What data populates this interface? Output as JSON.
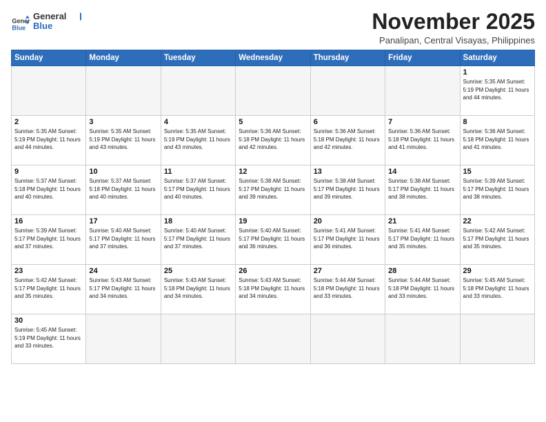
{
  "header": {
    "logo_line1": "General",
    "logo_line2": "Blue",
    "month": "November 2025",
    "location": "Panalipan, Central Visayas, Philippines"
  },
  "weekdays": [
    "Sunday",
    "Monday",
    "Tuesday",
    "Wednesday",
    "Thursday",
    "Friday",
    "Saturday"
  ],
  "weeks": [
    [
      {
        "day": "",
        "info": ""
      },
      {
        "day": "",
        "info": ""
      },
      {
        "day": "",
        "info": ""
      },
      {
        "day": "",
        "info": ""
      },
      {
        "day": "",
        "info": ""
      },
      {
        "day": "",
        "info": ""
      },
      {
        "day": "1",
        "info": "Sunrise: 5:35 AM\nSunset: 5:19 PM\nDaylight: 11 hours\nand 44 minutes."
      }
    ],
    [
      {
        "day": "2",
        "info": "Sunrise: 5:35 AM\nSunset: 5:19 PM\nDaylight: 11 hours\nand 44 minutes."
      },
      {
        "day": "3",
        "info": "Sunrise: 5:35 AM\nSunset: 5:19 PM\nDaylight: 11 hours\nand 43 minutes."
      },
      {
        "day": "4",
        "info": "Sunrise: 5:35 AM\nSunset: 5:19 PM\nDaylight: 11 hours\nand 43 minutes."
      },
      {
        "day": "5",
        "info": "Sunrise: 5:36 AM\nSunset: 5:18 PM\nDaylight: 11 hours\nand 42 minutes."
      },
      {
        "day": "6",
        "info": "Sunrise: 5:36 AM\nSunset: 5:18 PM\nDaylight: 11 hours\nand 42 minutes."
      },
      {
        "day": "7",
        "info": "Sunrise: 5:36 AM\nSunset: 5:18 PM\nDaylight: 11 hours\nand 41 minutes."
      },
      {
        "day": "8",
        "info": "Sunrise: 5:36 AM\nSunset: 5:18 PM\nDaylight: 11 hours\nand 41 minutes."
      }
    ],
    [
      {
        "day": "9",
        "info": "Sunrise: 5:37 AM\nSunset: 5:18 PM\nDaylight: 11 hours\nand 40 minutes."
      },
      {
        "day": "10",
        "info": "Sunrise: 5:37 AM\nSunset: 5:18 PM\nDaylight: 11 hours\nand 40 minutes."
      },
      {
        "day": "11",
        "info": "Sunrise: 5:37 AM\nSunset: 5:17 PM\nDaylight: 11 hours\nand 40 minutes."
      },
      {
        "day": "12",
        "info": "Sunrise: 5:38 AM\nSunset: 5:17 PM\nDaylight: 11 hours\nand 39 minutes."
      },
      {
        "day": "13",
        "info": "Sunrise: 5:38 AM\nSunset: 5:17 PM\nDaylight: 11 hours\nand 39 minutes."
      },
      {
        "day": "14",
        "info": "Sunrise: 5:38 AM\nSunset: 5:17 PM\nDaylight: 11 hours\nand 38 minutes."
      },
      {
        "day": "15",
        "info": "Sunrise: 5:39 AM\nSunset: 5:17 PM\nDaylight: 11 hours\nand 38 minutes."
      }
    ],
    [
      {
        "day": "16",
        "info": "Sunrise: 5:39 AM\nSunset: 5:17 PM\nDaylight: 11 hours\nand 37 minutes."
      },
      {
        "day": "17",
        "info": "Sunrise: 5:40 AM\nSunset: 5:17 PM\nDaylight: 11 hours\nand 37 minutes."
      },
      {
        "day": "18",
        "info": "Sunrise: 5:40 AM\nSunset: 5:17 PM\nDaylight: 11 hours\nand 37 minutes."
      },
      {
        "day": "19",
        "info": "Sunrise: 5:40 AM\nSunset: 5:17 PM\nDaylight: 11 hours\nand 36 minutes."
      },
      {
        "day": "20",
        "info": "Sunrise: 5:41 AM\nSunset: 5:17 PM\nDaylight: 11 hours\nand 36 minutes."
      },
      {
        "day": "21",
        "info": "Sunrise: 5:41 AM\nSunset: 5:17 PM\nDaylight: 11 hours\nand 35 minutes."
      },
      {
        "day": "22",
        "info": "Sunrise: 5:42 AM\nSunset: 5:17 PM\nDaylight: 11 hours\nand 35 minutes."
      }
    ],
    [
      {
        "day": "23",
        "info": "Sunrise: 5:42 AM\nSunset: 5:17 PM\nDaylight: 11 hours\nand 35 minutes."
      },
      {
        "day": "24",
        "info": "Sunrise: 5:43 AM\nSunset: 5:17 PM\nDaylight: 11 hours\nand 34 minutes."
      },
      {
        "day": "25",
        "info": "Sunrise: 5:43 AM\nSunset: 5:18 PM\nDaylight: 11 hours\nand 34 minutes."
      },
      {
        "day": "26",
        "info": "Sunrise: 5:43 AM\nSunset: 5:18 PM\nDaylight: 11 hours\nand 34 minutes."
      },
      {
        "day": "27",
        "info": "Sunrise: 5:44 AM\nSunset: 5:18 PM\nDaylight: 11 hours\nand 33 minutes."
      },
      {
        "day": "28",
        "info": "Sunrise: 5:44 AM\nSunset: 5:18 PM\nDaylight: 11 hours\nand 33 minutes."
      },
      {
        "day": "29",
        "info": "Sunrise: 5:45 AM\nSunset: 5:18 PM\nDaylight: 11 hours\nand 33 minutes."
      }
    ],
    [
      {
        "day": "30",
        "info": "Sunrise: 5:45 AM\nSunset: 5:19 PM\nDaylight: 11 hours\nand 33 minutes."
      },
      {
        "day": "",
        "info": ""
      },
      {
        "day": "",
        "info": ""
      },
      {
        "day": "",
        "info": ""
      },
      {
        "day": "",
        "info": ""
      },
      {
        "day": "",
        "info": ""
      },
      {
        "day": "",
        "info": ""
      }
    ]
  ]
}
